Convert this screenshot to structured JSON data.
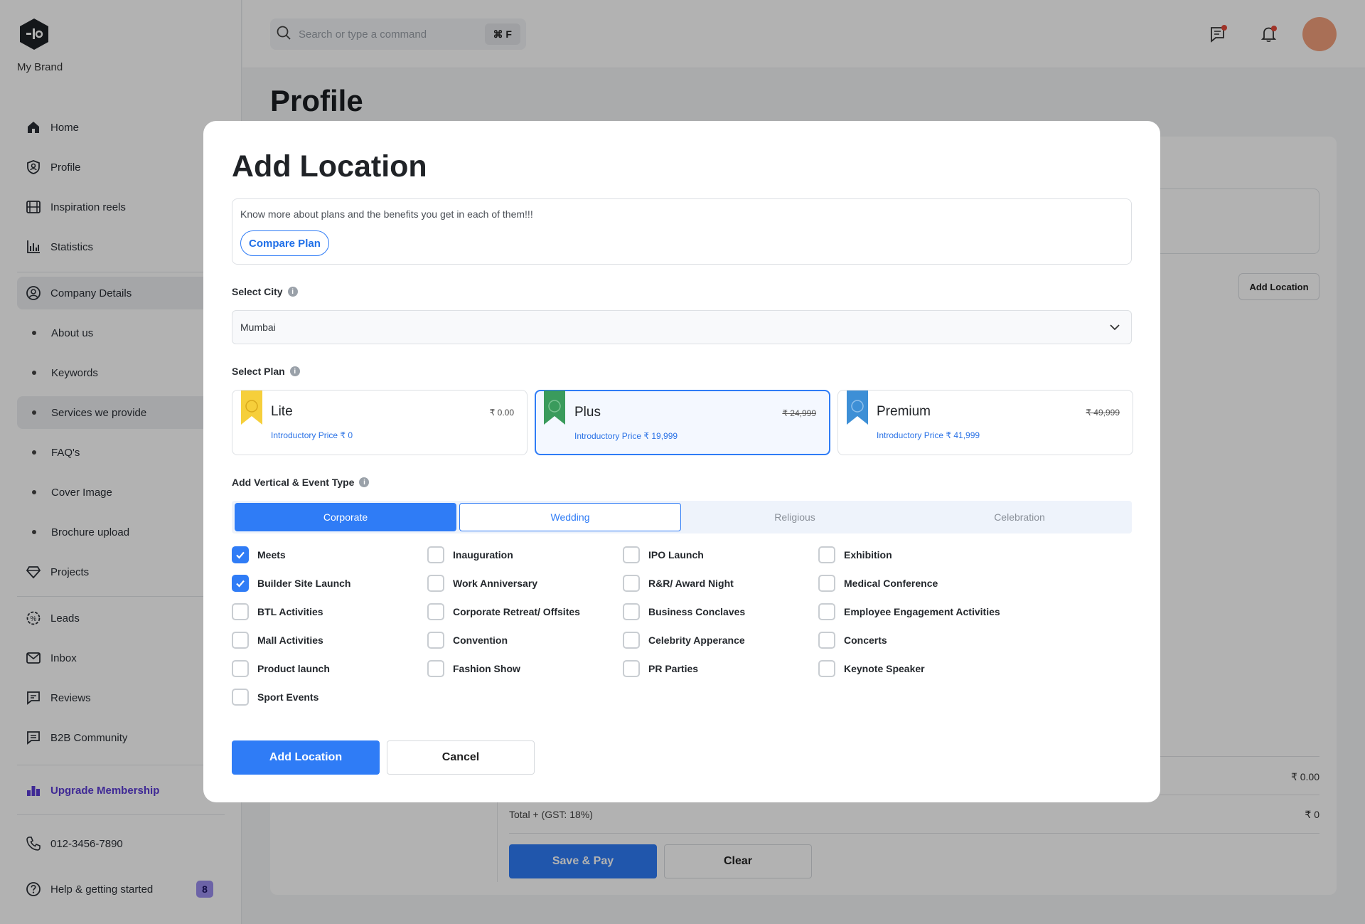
{
  "brand": {
    "name": "My Brand"
  },
  "sidebar": {
    "items": [
      {
        "label": "Home",
        "icon": "home-icon"
      },
      {
        "label": "Profile",
        "icon": "profile-icon"
      },
      {
        "label": "Inspiration reels",
        "icon": "film-icon"
      },
      {
        "label": "Statistics",
        "icon": "bar-chart-icon"
      },
      {
        "label": "Company Details",
        "icon": "user-circle-icon"
      },
      {
        "label": "About us"
      },
      {
        "label": "Keywords"
      },
      {
        "label": "Services we provide"
      },
      {
        "label": "FAQ's"
      },
      {
        "label": "Cover Image"
      },
      {
        "label": "Brochure upload"
      },
      {
        "label": "Projects",
        "icon": "diamond-icon"
      },
      {
        "label": "Leads",
        "icon": "leads-icon"
      },
      {
        "label": "Inbox",
        "icon": "mail-icon"
      },
      {
        "label": "Reviews",
        "icon": "message-icon"
      },
      {
        "label": "B2B Community",
        "icon": "chat-icon"
      },
      {
        "label": "Upgrade Membership",
        "icon": "upgrade-icon"
      },
      {
        "label": "012-3456-7890",
        "icon": "phone-icon"
      },
      {
        "label": "Help & getting started",
        "icon": "help-icon",
        "badge": "8"
      }
    ]
  },
  "topbar": {
    "search_placeholder": "Search or type a command",
    "shortcut": "⌘ F"
  },
  "page": {
    "title": "Profile",
    "add_location": "Add Location",
    "row_value": "₹ 0.00",
    "total_label": "Total + (GST: 18%)",
    "total_value": "₹ 0",
    "save_pay": "Save & Pay",
    "clear": "Clear"
  },
  "modal": {
    "title": "Add Location",
    "info_text": "Know more about plans and the benefits you get in each of them!!!",
    "compare_plan": "Compare Plan",
    "city_label": "Select City",
    "city_value": "Mumbai",
    "plan_label": "Select Plan",
    "plans": [
      {
        "name": "Lite",
        "price": "₹ 0.00",
        "intro": "Introductory Price ₹ 0",
        "ribbon_color": "#f6cf3b"
      },
      {
        "name": "Plus",
        "price": "₹ 24,999",
        "intro": "Introductory Price ₹ 19,999",
        "ribbon_color": "#3a9b5c"
      },
      {
        "name": "Premium",
        "price": "₹ 49,999",
        "intro": "Introductory Price ₹ 41,999",
        "ribbon_color": "#3d8fd6"
      }
    ],
    "vertical_label": "Add Vertical & Event Type",
    "tabs": [
      "Corporate",
      "Wedding",
      "Religious",
      "Celebration"
    ],
    "events": [
      {
        "label": "Meets",
        "checked": true
      },
      {
        "label": "Builder Site Launch",
        "checked": true
      },
      {
        "label": "BTL Activities",
        "checked": false
      },
      {
        "label": "Mall Activities",
        "checked": false
      },
      {
        "label": "Product launch",
        "checked": false
      },
      {
        "label": "Sport Events",
        "checked": false
      },
      {
        "label": "Inauguration",
        "checked": false
      },
      {
        "label": "Work Anniversary",
        "checked": false
      },
      {
        "label": "Corporate Retreat/ Offsites",
        "checked": false
      },
      {
        "label": "Convention",
        "checked": false
      },
      {
        "label": "Fashion Show",
        "checked": false
      },
      {
        "label": "IPO Launch",
        "checked": false
      },
      {
        "label": "R&R/ Award Night",
        "checked": false
      },
      {
        "label": "Business Conclaves",
        "checked": false
      },
      {
        "label": "Celebrity Apperance",
        "checked": false
      },
      {
        "label": "PR Parties",
        "checked": false
      },
      {
        "label": "Exhibition",
        "checked": false
      },
      {
        "label": "Medical Conference",
        "checked": false
      },
      {
        "label": "Employee Engagement Activities",
        "checked": false
      },
      {
        "label": "Concerts",
        "checked": false
      },
      {
        "label": "Keynote Speaker",
        "checked": false
      }
    ],
    "add_button": "Add Location",
    "cancel_button": "Cancel"
  },
  "colors": {
    "accent": "#2f7cf6",
    "upgrade": "#5b3bd6",
    "avatar": "#f2a07b",
    "notification": "#e5493a"
  }
}
